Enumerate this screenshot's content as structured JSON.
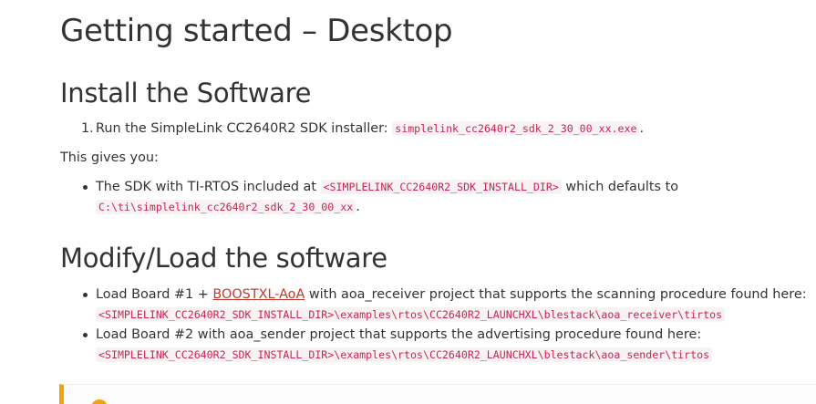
{
  "page_title": "Getting started – Desktop",
  "install": {
    "heading": "Install the Software",
    "steps": [
      {
        "number": "1.",
        "text": "Run the SimpleLink CC2640R2 SDK installer:",
        "code": "simplelink_cc2640r2_sdk_2_30_00_xx.exe",
        "suffix": "."
      }
    ],
    "gives_you": "This gives you:",
    "bullets": [
      {
        "text_before": "The SDK with TI-RTOS included at",
        "code1": "<SIMPLELINK_CC2640R2_SDK_INSTALL_DIR>",
        "text_middle": "which defaults to",
        "code2": "C:\\ti\\simplelink_cc2640r2_sdk_2_30_00_xx",
        "suffix": "."
      }
    ]
  },
  "modify": {
    "heading": "Modify/Load the software",
    "bullets": [
      {
        "text_before": "Load Board #1 +",
        "link": "BOOSTXL-AoA",
        "text_after": "with aoa_receiver project that supports the scanning procedure found here:",
        "code_path": "<SIMPLELINK_CC2640R2_SDK_INSTALL_DIR>\\examples\\rtos\\CC2640R2_LAUNCHXL\\blestack\\aoa_receiver\\tirtos"
      },
      {
        "text_before": "Load Board #2 with aoa_sender project that supports the advertising procedure found here:",
        "code_path": "<SIMPLELINK_CC2640R2_SDK_INSTALL_DIR>\\examples\\rtos\\CC2640R2_LAUNCHXL\\blestack\\aoa_sender\\tirtos"
      }
    ]
  },
  "colors": {
    "text": "#333333",
    "code": "#c7254e",
    "code_bg": "#f9f2f4",
    "link": "#c0392b",
    "callout_accent": "#f0a30a"
  }
}
